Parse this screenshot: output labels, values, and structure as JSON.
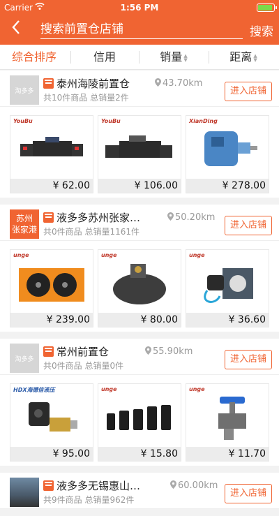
{
  "status_bar": {
    "carrier": "Carrier",
    "time": "1:56 PM"
  },
  "nav": {
    "title": "搜索前置仓店铺",
    "search_label": "搜索"
  },
  "sort_tabs": [
    {
      "label": "综合排序",
      "active": true
    },
    {
      "label": "信用",
      "active": false
    },
    {
      "label": "销量",
      "active": false
    },
    {
      "label": "距离",
      "active": false
    }
  ],
  "stores": [
    {
      "logo_text": "淘多多",
      "name": "泰州海陵前置仓",
      "meta": "共10件商品 总销量2件",
      "distance": "43.70km",
      "enter_label": "进入店铺",
      "products": [
        {
          "brand": "YouBu",
          "price": "¥ 62.00"
        },
        {
          "brand": "YouBu",
          "price": "¥ 106.00"
        },
        {
          "brand": "XianDing",
          "price": "¥ 278.00"
        }
      ]
    },
    {
      "logo_text_1": "苏州",
      "logo_text_2": "张家港",
      "name": "液多多苏州张家港前置仓",
      "meta": "共0件商品 总销量1161件",
      "distance": "50.20km",
      "enter_label": "进入店铺",
      "products": [
        {
          "brand": "unge",
          "price": "¥ 239.00"
        },
        {
          "brand": "unge",
          "price": "¥ 80.00"
        },
        {
          "brand": "unge",
          "price": "¥ 36.60"
        }
      ]
    },
    {
      "logo_text": "淘多多",
      "name": "常州前置仓",
      "meta": "共0件商品 总销量0件",
      "distance": "55.90km",
      "enter_label": "进入店铺",
      "products": [
        {
          "brand": "HDX海德信液压",
          "price": "¥ 95.00"
        },
        {
          "brand": "unge",
          "price": "¥ 15.80"
        },
        {
          "brand": "unge",
          "price": "¥ 11.70"
        }
      ]
    },
    {
      "name": "液多多无锡惠山区前置仓",
      "meta": "共9件商品 总销量962件",
      "distance": "60.00km",
      "enter_label": "进入店铺"
    }
  ]
}
